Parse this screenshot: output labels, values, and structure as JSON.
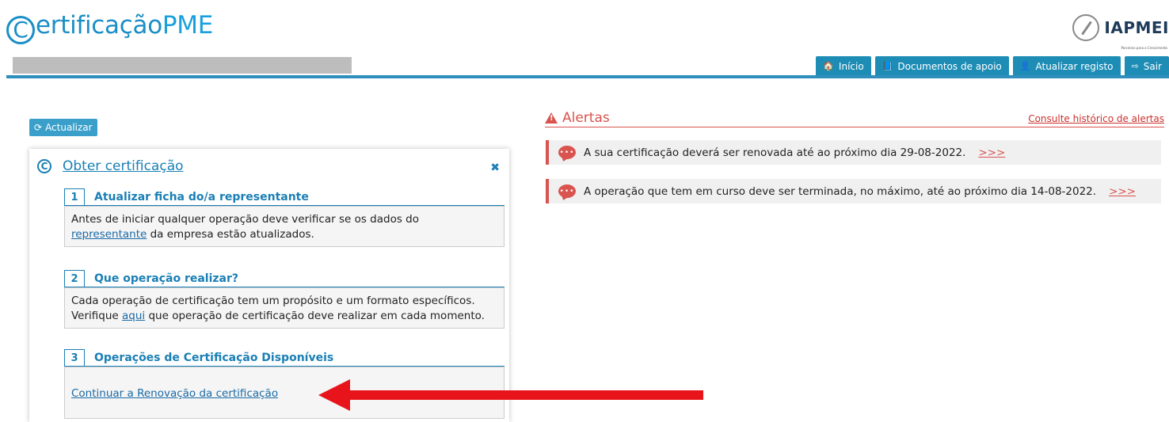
{
  "header": {
    "logo_c": "C",
    "logo_text": "ertificação",
    "logo_pme": "PME",
    "partner_name": "IAPMEI",
    "partner_sub": "Parceiros para o Crescimento"
  },
  "nav": [
    {
      "icon": "home-icon",
      "glyph": "🏠",
      "label": "Início"
    },
    {
      "icon": "book-icon",
      "glyph": "📘",
      "label": "Documentos de apoio"
    },
    {
      "icon": "user-icon",
      "glyph": "👤",
      "label": "Atualizar registo"
    },
    {
      "icon": "logout-icon",
      "glyph": "⇨",
      "label": "Sair"
    }
  ],
  "refresh": {
    "glyph": "⟳",
    "label": "Actualizar"
  },
  "card": {
    "icon_glyph": "C",
    "title": "Obter certificação",
    "close_glyph": "✖",
    "steps": [
      {
        "num": "1",
        "title": "Atualizar ficha do/a representante",
        "line1": "Antes de iniciar qualquer operação deve verificar se os dados do",
        "link": "representante",
        "line2": " da empresa estão atualizados."
      },
      {
        "num": "2",
        "title": "Que operação realizar?",
        "line1": "Cada operação de certificação tem um propósito e um formato específicos.",
        "pre": "Verifique ",
        "link": "aqui",
        "line2": " que operação de certificação deve realizar em cada momento."
      },
      {
        "num": "3",
        "title": "Operações de Certificação Disponíveis",
        "link": "Continuar a Renovação da certificação"
      }
    ]
  },
  "alerts": {
    "title": "Alertas",
    "history_link": "Consulte histórico de alertas",
    "items": [
      {
        "text": "A sua certificação deverá ser renovada até ao próximo dia 29-08-2022.",
        "more": ">>>"
      },
      {
        "text": "A operação que tem em curso deve ser terminada, no máximo, até ao próximo dia 14-08-2022.",
        "more": ">>>"
      }
    ]
  },
  "colors": {
    "brand": "#1a8ec6",
    "nav": "#1e8db6",
    "alert": "#d9534f",
    "annotation_arrow": "#e8141b"
  }
}
